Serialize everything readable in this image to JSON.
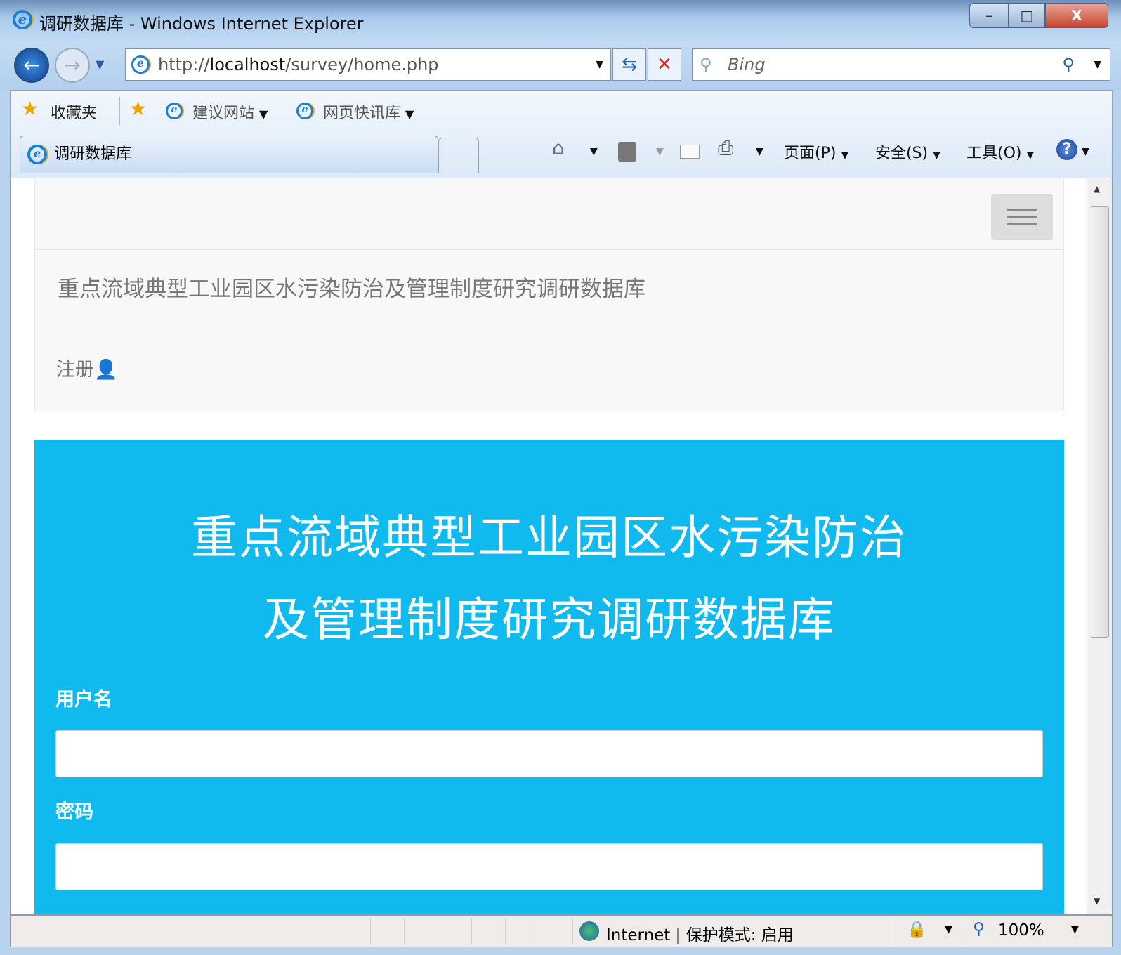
{
  "window": {
    "title": "调研数据库 - Windows Internet Explorer",
    "minimize": "–",
    "maximize": "□",
    "close": "X"
  },
  "nav": {
    "url_prefix": "http://",
    "url_host": "localhost",
    "url_path": "/survey/home.php",
    "search_placeholder": "Bing"
  },
  "favorites": {
    "label": "收藏夹",
    "items": [
      "建议网站",
      "网页快讯库"
    ]
  },
  "tab": {
    "title": "调研数据库"
  },
  "commands": {
    "page": "页面(P)",
    "safety": "安全(S)",
    "tools": "工具(O)"
  },
  "page": {
    "site_title": "重点流域典型工业园区水污染防治及管理制度研究调研数据库",
    "register_link": "注册",
    "heading_line1": "重点流域典型工业园区水污染防治",
    "heading_line2": "及管理制度研究调研数据库",
    "username_label": "用户名",
    "username_value": "",
    "password_label": "密码",
    "password_value": ""
  },
  "status": {
    "zone": "Internet | 保护模式: 启用",
    "zoom": "100%"
  },
  "colors": {
    "accent": "#10b9ee"
  }
}
